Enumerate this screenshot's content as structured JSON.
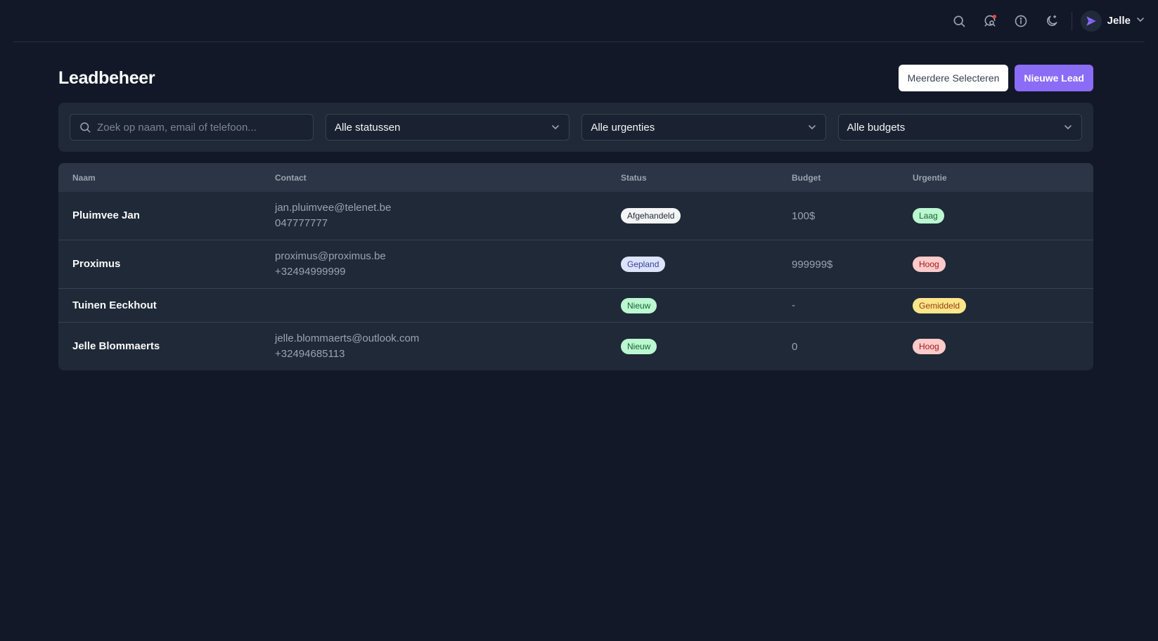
{
  "topbar": {
    "user_name": "Jelle",
    "icons": [
      "search-icon",
      "notification-search-icon",
      "info-icon",
      "moon-icon"
    ]
  },
  "header": {
    "title": "Leadbeheer",
    "select_multiple_label": "Meerdere Selecteren",
    "new_lead_label": "Nieuwe Lead"
  },
  "filters": {
    "search_placeholder": "Zoek op naam, email of telefoon...",
    "status": "Alle statussen",
    "urgency": "Alle urgenties",
    "budget": "Alle budgets"
  },
  "table": {
    "headers": {
      "name": "Naam",
      "contact": "Contact",
      "status": "Status",
      "budget": "Budget",
      "urgency": "Urgentie"
    },
    "rows": [
      {
        "name": "Pluimvee Jan",
        "email": "jan.pluimvee@telenet.be",
        "phone": "047777777",
        "status": "Afgehandeld",
        "budget": "100$",
        "urgency": "Laag"
      },
      {
        "name": "Proximus",
        "email": "proximus@proximus.be",
        "phone": "+32494999999",
        "status": "Gepland",
        "budget": "999999$",
        "urgency": "Hoog"
      },
      {
        "name": "Tuinen Eeckhout",
        "email": "",
        "phone": "",
        "status": "Nieuw",
        "budget": "-",
        "urgency": "Gemiddeld"
      },
      {
        "name": "Jelle Blommaerts",
        "email": "jelle.blommaerts@outlook.com",
        "phone": "+32494685113",
        "status": "Nieuw",
        "budget": "0",
        "urgency": "Hoog"
      }
    ]
  },
  "colors": {
    "background": "#121827",
    "panel": "#1f2937",
    "accent": "#8b6cf6",
    "notification_dot": "#ef4444"
  }
}
